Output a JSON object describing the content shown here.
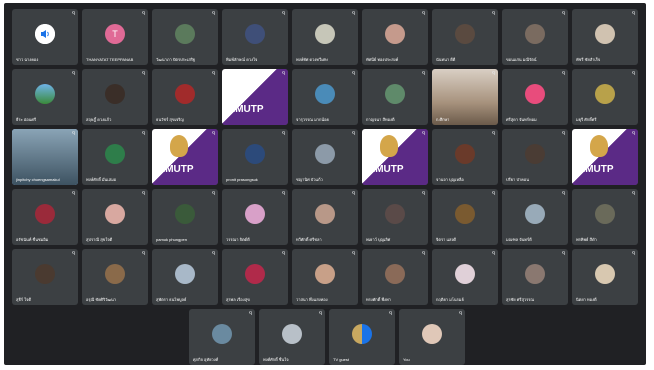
{
  "participants": [
    [
      {
        "name": "ชาว ฉางคอง"
      },
      {
        "name": "THANYATAT TEEPPANAB"
      },
      {
        "name": "วัฒนาภา ปัตรประเสริฐ"
      },
      {
        "name": "พิมพ์ลักษณ์ ดวงใจ"
      },
      {
        "name": "พงษ์ทัศ ดวงทวีเศษ"
      },
      {
        "name": "ทัศนีย์ ทองประสงค์"
      },
      {
        "name": "นันทนา ดีดี"
      },
      {
        "name": "ขอนแก่น มณีรัตน์"
      },
      {
        "name": "พัชรี ชัยสำเร็จ"
      }
    ],
    [
      {
        "name": "ธีระ อ่อนศรี"
      },
      {
        "name": "สฤษฎิ์ ดวงแก้ว"
      },
      {
        "name": "ธนวัชร์ สุขเจริญ"
      },
      {
        "name": "RMUTP"
      },
      {
        "name": "จารุวรรณ มากน้อย"
      },
      {
        "name": "กาญจนา สีทองดี"
      },
      {
        "name": "ก.ศึกษา"
      },
      {
        "name": "ศรีสุดา จันทร์หอม"
      },
      {
        "name": "มยุรี ศักดิ์ศรี"
      }
    ],
    [
      {
        "name": "jinpitchy chuengsamakul"
      },
      {
        "name": "พงษ์ศักดิ์ มั่นเสมอ"
      },
      {
        "name": "RMUTP"
      },
      {
        "name": "pronit prasongsuk"
      },
      {
        "name": "ชญานิศ บัวแก้ว"
      },
      {
        "name": "RMUTP"
      },
      {
        "name": "จานจา บุญเหลือ"
      },
      {
        "name": "ปรียา ป่าคอน"
      },
      {
        "name": "RMUTP"
      }
    ],
    [
      {
        "name": "อรัชนันท์ ชื่นชมอิม"
      },
      {
        "name": "สุปราณี สุขใจดี"
      },
      {
        "name": "pamuk phungpen"
      },
      {
        "name": "วรรณา จิตต์ดี"
      },
      {
        "name": "ทวีศักดิ์ ศรีชลา"
      },
      {
        "name": "พเยาว์ บุญเลิศ"
      },
      {
        "name": "จิตรา แสงดี"
      },
      {
        "name": "มณฑล จันทร์ดี"
      },
      {
        "name": "พรทิพย์ สีดำ"
      }
    ],
    [
      {
        "name": "สุธีร์ ใจดี"
      },
      {
        "name": "อรุณี ชัยศิริวัฒนา"
      },
      {
        "name": "สุพัตรา ธนไพบูลย์"
      },
      {
        "name": "สุรพล เรืองสุข"
      },
      {
        "name": "วาสนา พึ่งแสงทอง"
      },
      {
        "name": "ทรงศักดิ์ พึ่งพา"
      },
      {
        "name": "กฤติยา มโนรมย์"
      },
      {
        "name": "สุรชัย ศรีสุวรรณ"
      },
      {
        "name": "นิตยา ทองดี"
      }
    ],
    [
      {
        "name": "ศุภกิจ อุทัยวงศ์"
      },
      {
        "name": "พงศ์ศักดิ์ ชื่นใจ"
      },
      {
        "name": "TV guest"
      },
      {
        "name": "You"
      }
    ]
  ]
}
